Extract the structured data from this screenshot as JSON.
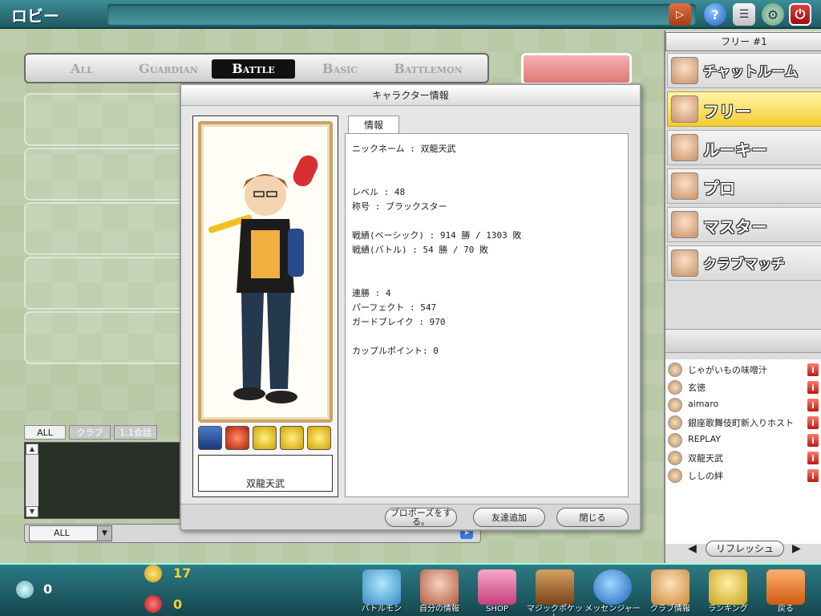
{
  "window": {
    "title": "ロビー"
  },
  "categories": [
    {
      "label": "All",
      "active": false
    },
    {
      "label": "Guardian",
      "active": false
    },
    {
      "label": "Battle",
      "active": true
    },
    {
      "label": "Basic",
      "active": false
    },
    {
      "label": "Battlemon",
      "active": false
    }
  ],
  "chat": {
    "tabs": [
      "ALL",
      "クラブ",
      "1:1会話"
    ],
    "filter_value": "ALL"
  },
  "right_panel": {
    "header": "フリー #1",
    "rooms": [
      {
        "label": "チャットルーム",
        "active": false
      },
      {
        "label": "フリー",
        "active": true
      },
      {
        "label": "ルーキー",
        "active": false
      },
      {
        "label": "プロ",
        "active": false
      },
      {
        "label": "マスター",
        "active": false
      },
      {
        "label": "クラブマッチ",
        "active": false
      }
    ],
    "users": [
      {
        "name": "じゃがいもの味噌汁",
        "badge": "i"
      },
      {
        "name": "玄徳",
        "badge": "i"
      },
      {
        "name": "aimaro",
        "badge": "i"
      },
      {
        "name": "銀座歌舞伎町新入りホスト",
        "badge": "i"
      },
      {
        "name": "REPLAY",
        "badge": "i"
      },
      {
        "name": "双龍天武",
        "badge": "i"
      },
      {
        "name": "ししの絆",
        "badge": "i"
      }
    ],
    "refresh_label": "リフレッシュ"
  },
  "status": {
    "gems": "0",
    "coins": "17",
    "hearts": "0"
  },
  "bottom_buttons": [
    {
      "label": "バトルモン"
    },
    {
      "label": "自分の情報"
    },
    {
      "label": "SHOP"
    },
    {
      "label": "マジックポケット"
    },
    {
      "label": "メッセンジャー"
    },
    {
      "label": "クラブ情報"
    },
    {
      "label": "ランキング"
    },
    {
      "label": "戻る"
    }
  ],
  "modal": {
    "title": "キャラクター情報",
    "tab": "情報",
    "character_name": "双龍天武",
    "info_lines": [
      "ニックネーム : 双龍天武",
      "レベル : 48",
      "称号 : ブラックスター",
      "戦績(ベーシック) : 914 勝 / 1303 敗",
      "戦績(バトル) : 54 勝 / 70 敗",
      "連勝 : 4",
      "パーフェクト : 547",
      "ガードブレイク : 970",
      "カップルポイント:  0"
    ],
    "buttons": {
      "propose": "プロポーズをする。",
      "add_friend": "友達追加",
      "close": "閉じる"
    }
  },
  "colors": {
    "accent_teal": "#2c7a85",
    "active_room": "#f5cc30",
    "badge_red": "#c01810"
  }
}
